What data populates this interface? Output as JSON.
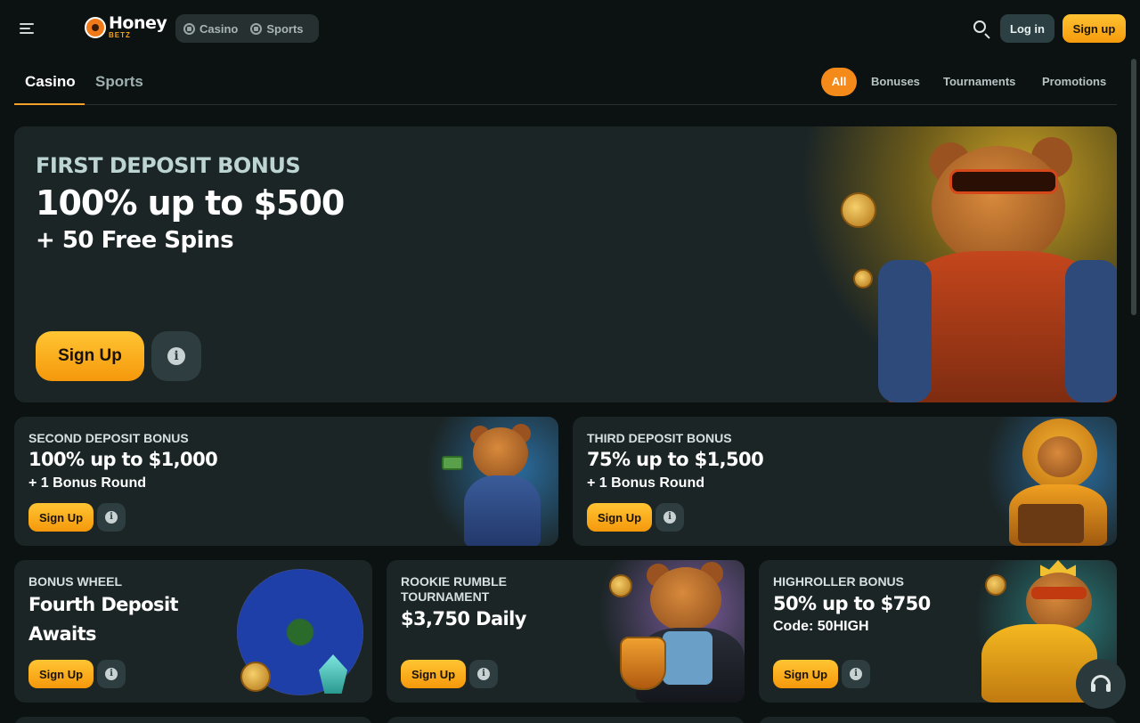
{
  "header": {
    "menu_icon": "hamburger-menu-icon",
    "logo_text": "Honey",
    "logo_sub": "BETZ",
    "modes": [
      {
        "label": "Casino",
        "icon": "casino-chip-icon"
      },
      {
        "label": "Sports",
        "icon": "sports-ball-icon"
      }
    ],
    "search_icon": "search-icon",
    "login_label": "Log in",
    "signup_label": "Sign up"
  },
  "subnav": {
    "tabs": [
      {
        "label": "Casino",
        "active": true
      },
      {
        "label": "Sports",
        "active": false
      }
    ],
    "filters": [
      {
        "label": "All",
        "active": true
      },
      {
        "label": "Bonuses",
        "active": false
      },
      {
        "label": "Tournaments",
        "active": false
      },
      {
        "label": "Promotions",
        "active": false
      }
    ]
  },
  "hero": {
    "kicker": "FIRST DEPOSIT BONUS",
    "title": "100% up to  $500",
    "subtitle": "+ 50 Free Spins",
    "cta": "Sign Up",
    "info_icon": "info-icon"
  },
  "cards": [
    {
      "kicker": "SECOND DEPOSIT BONUS",
      "title": "100% up to  $1,000",
      "sub": "+ 1 Bonus Round",
      "cta": "Sign Up"
    },
    {
      "kicker": "THIRD DEPOSIT BONUS",
      "title": "75% up to  $1,500",
      "sub": "+ 1 Bonus Round",
      "cta": "Sign Up"
    },
    {
      "kicker": "BONUS WHEEL",
      "title_line1": "Fourth Deposit",
      "title_line2": "Awaits",
      "cta": "Sign Up"
    },
    {
      "kicker_line1": "ROOKIE RUMBLE",
      "kicker_line2": "TOURNAMENT",
      "title": "$3,750 Daily",
      "cta": "Sign Up"
    },
    {
      "kicker": "HIGHROLLER BONUS",
      "title": "50% up to $750",
      "sub": "Code: 50HIGH",
      "cta": "Sign Up"
    }
  ],
  "support_icon": "headset-support-icon",
  "colors": {
    "accent": "#f59b0c",
    "background": "#0c1111",
    "card": "#1b2526"
  }
}
